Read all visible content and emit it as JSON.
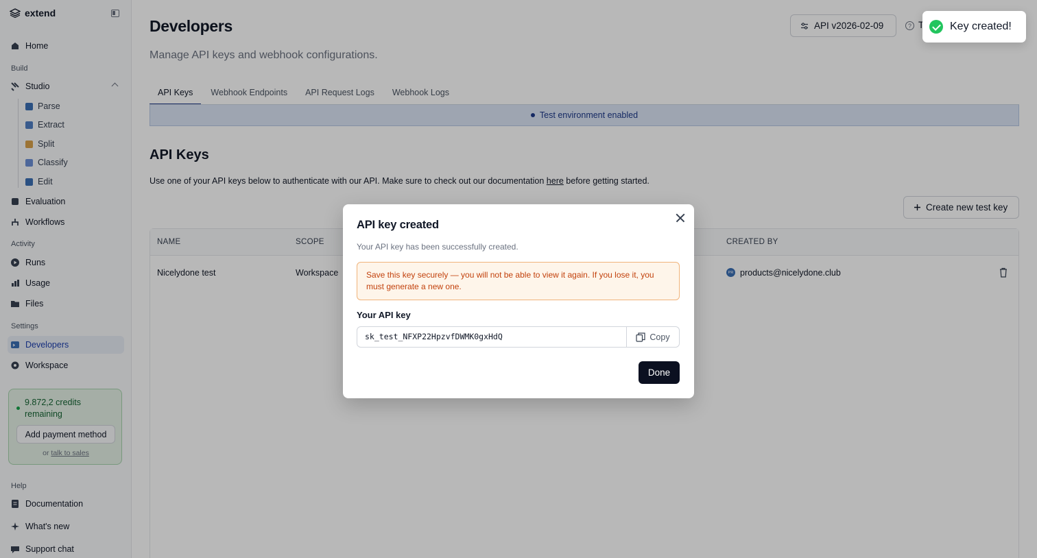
{
  "app": {
    "brand": "extend"
  },
  "sidebar": {
    "home": "Home",
    "build_label": "Build",
    "studio": "Studio",
    "studio_items": [
      "Parse",
      "Extract",
      "Split",
      "Classify",
      "Edit"
    ],
    "evaluation": "Evaluation",
    "workflows": "Workflows",
    "activity_label": "Activity",
    "runs": "Runs",
    "usage": "Usage",
    "files": "Files",
    "settings_label": "Settings",
    "developers": "Developers",
    "workspace": "Workspace",
    "credits_text": "9.872,2 credits remaining",
    "add_payment": "Add payment method",
    "or_text": "or",
    "talk_to_sales": "talk to sales",
    "help_label": "Help",
    "documentation": "Documentation",
    "whats_new": "What's new",
    "support_chat": "Support chat"
  },
  "header": {
    "title": "Developers",
    "subtitle": "Manage API keys and webhook configurations.",
    "api_version": "API v2026-02-09",
    "help_partial": "T"
  },
  "tabs": [
    "API Keys",
    "Webhook Endpoints",
    "API Request Logs",
    "Webhook Logs"
  ],
  "env_banner": "Test environment enabled",
  "api_keys": {
    "title": "API Keys",
    "desc_before": "Use one of your API keys below to authenticate with our API. Make sure to check out our documentation ",
    "desc_link": "here",
    "desc_after": " before getting started.",
    "create_button": "Create new test key",
    "columns": {
      "name": "NAME",
      "scope": "SCOPE",
      "created_by": "CREATED BY"
    },
    "rows": [
      {
        "name": "Nicelydone test",
        "scope": "Workspace",
        "avatar": "PR",
        "created_by": "products@nicelydone.club"
      }
    ]
  },
  "modal": {
    "title": "API key created",
    "description": "Your API key has been successfully created.",
    "warning": "Save this key securely — you will not be able to view it again. If you lose it, you must generate a new one.",
    "key_label": "Your API key",
    "key_value": "sk_test_NFXP22HpzvfDWMK0gxHdQ",
    "copy_label": "Copy",
    "done_label": "Done"
  },
  "toast": {
    "message": "Key created!"
  },
  "colors": {
    "primary_dark": "#0b1020",
    "active_blue": "#1e40af",
    "success": "#22c55e",
    "warning": "#c2410c"
  }
}
